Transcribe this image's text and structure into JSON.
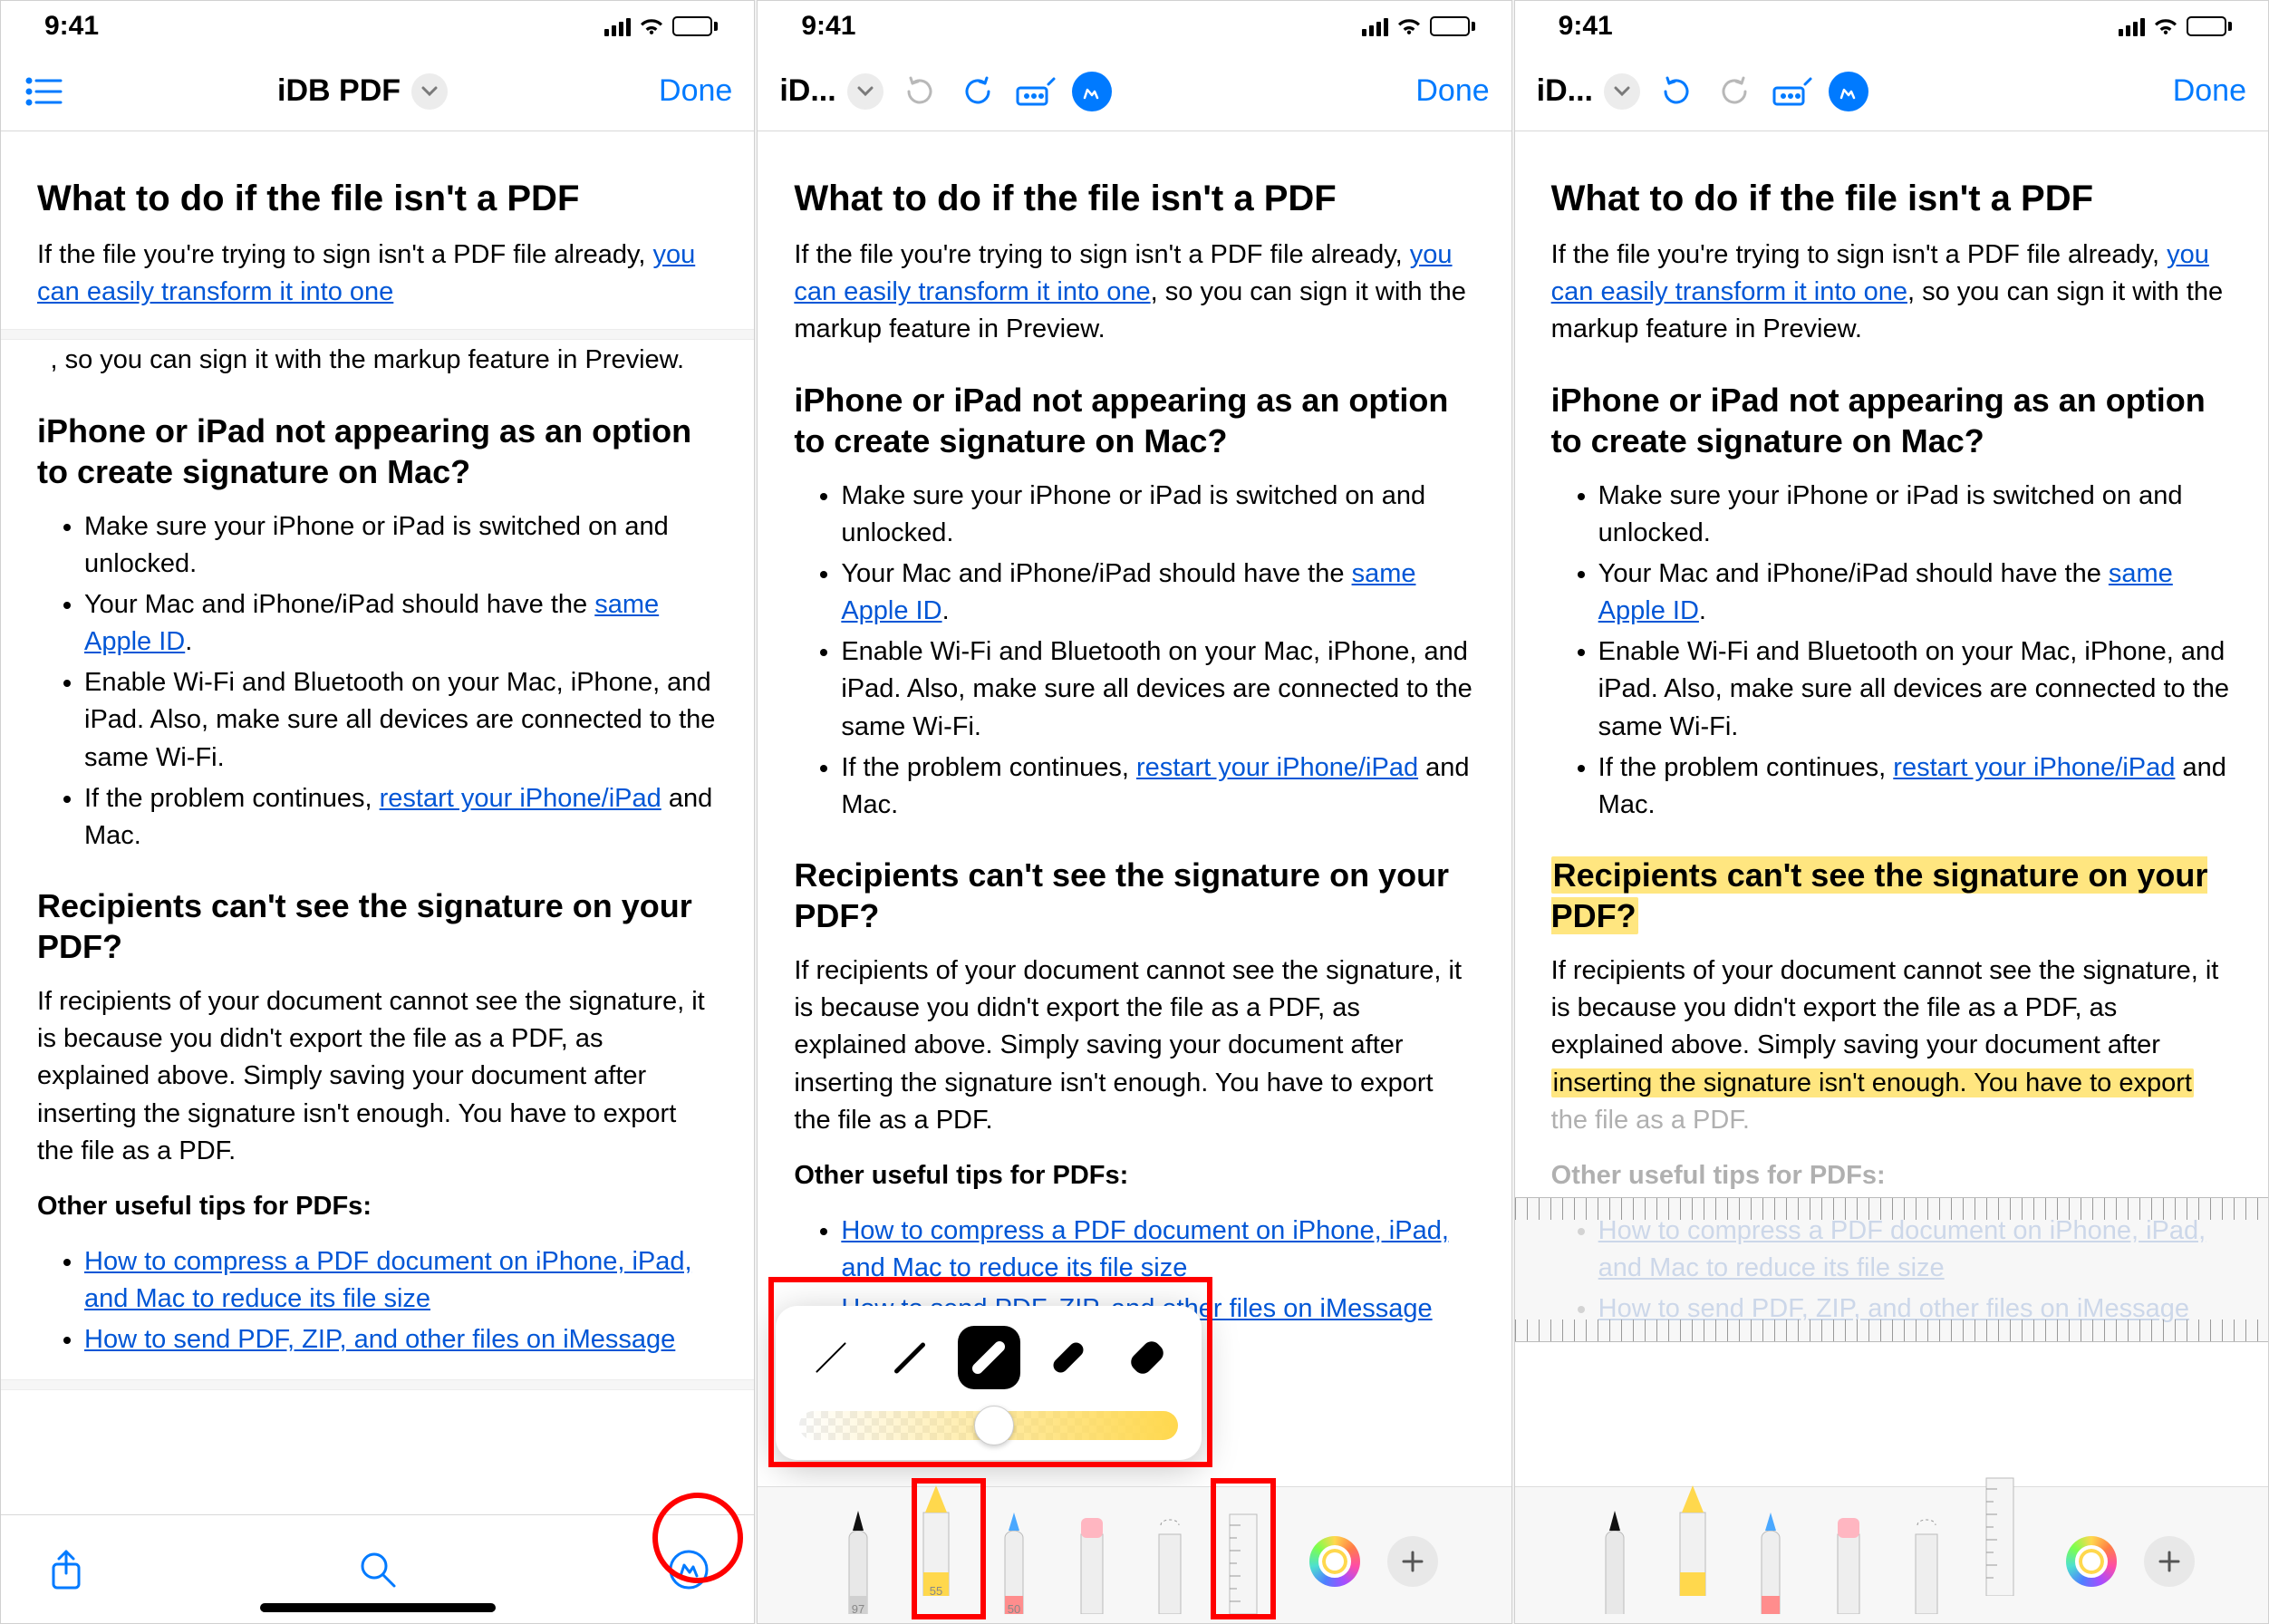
{
  "status": {
    "time": "9:41"
  },
  "nav": {
    "doc_title_full": "iDB PDF",
    "doc_title_short": "iD...",
    "done": "Done"
  },
  "doc": {
    "h1": "What to do if the file isn't a PDF",
    "p1a": "If the file you're trying to sign isn't a PDF file already, ",
    "p1_link": "you can easily transform it into one",
    "p1b": ", so you can sign it with the markup feature in Preview.",
    "h2": "iPhone or iPad not appearing as an option to create signature on Mac?",
    "li1": "Make sure your iPhone or iPad is switched on and unlocked.",
    "li2a": "Your Mac and iPhone/iPad should have the ",
    "li2_link": "same Apple ID",
    "li2b": ".",
    "li3": "Enable Wi-Fi and Bluetooth on your Mac, iPhone, and iPad. Also, make sure all devices are connected to the same Wi-Fi.",
    "li4a": "If the problem continues, ",
    "li4_link": "restart your iPhone/iPad",
    "li4b": " and Mac.",
    "h3": "Recipients can't see the signature on your PDF?",
    "p2_full": "If recipients of your document cannot see the signature, it is because you didn't export the file as a PDF, as explained above. Simply saving your document after inserting the signature isn't enough. You have to export the file as a PDF.",
    "p2_part1": "If recipients of your document cannot see the signature, it is because you didn't export the file as a PDF, as explained above. Simply saving your document after ",
    "p2_hl": "inserting the signature isn't enough. You have to export",
    "p2_part2": " the file as a PDF.",
    "h4": "Other useful tips for PDFs:",
    "tip1": "How to compress a PDF document on iPhone, iPad, and Mac to reduce its file size",
    "tip2": "How to send PDF, ZIP, and other files on iMessage"
  },
  "tools": {
    "pen_label": "97",
    "highlighter_label": "55",
    "pencil_label": "50"
  }
}
